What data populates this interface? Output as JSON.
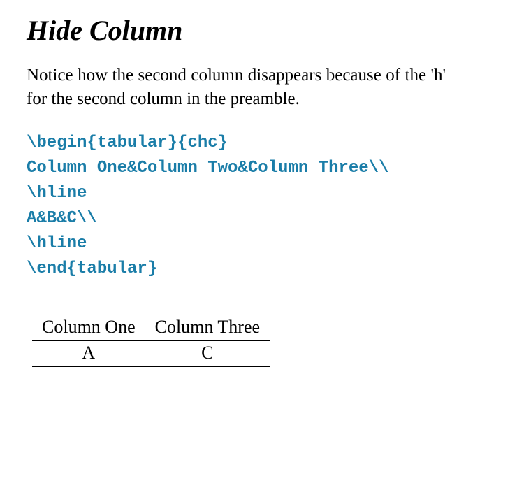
{
  "title": "Hide Column",
  "description": "Notice how the second column disappears because of the 'h' for the second column in the preamble.",
  "code": {
    "line1": "\\begin{tabular}{chc}",
    "line2": "Column One&Column Two&Column Three\\\\",
    "line3": "\\hline",
    "line4": "A&B&C\\\\",
    "line5": "\\hline",
    "line6": "\\end{tabular}"
  },
  "table": {
    "headers": [
      "Column One",
      "Column Three"
    ],
    "row1": [
      "A",
      "C"
    ]
  }
}
